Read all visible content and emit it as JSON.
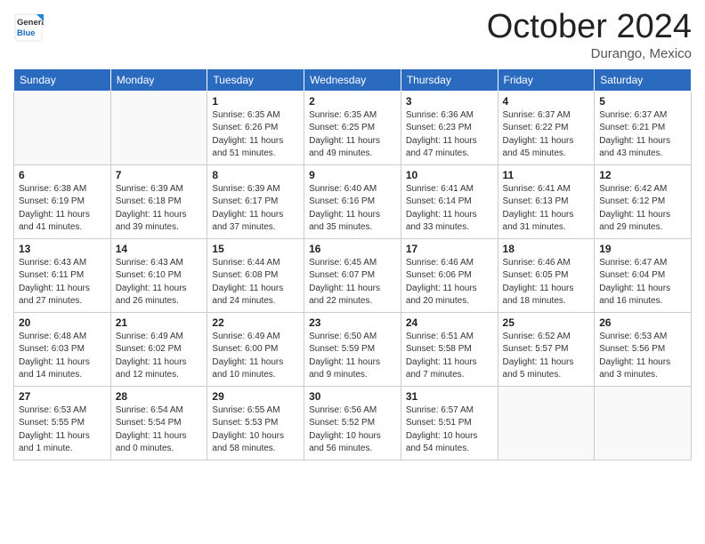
{
  "header": {
    "logo": {
      "general": "General",
      "blue": "Blue"
    },
    "title": "October 2024",
    "subtitle": "Durango, Mexico"
  },
  "weekdays": [
    "Sunday",
    "Monday",
    "Tuesday",
    "Wednesday",
    "Thursday",
    "Friday",
    "Saturday"
  ],
  "weeks": [
    [
      {
        "day": "",
        "info": ""
      },
      {
        "day": "",
        "info": ""
      },
      {
        "day": "1",
        "info": "Sunrise: 6:35 AM\nSunset: 6:26 PM\nDaylight: 11 hours and 51 minutes."
      },
      {
        "day": "2",
        "info": "Sunrise: 6:35 AM\nSunset: 6:25 PM\nDaylight: 11 hours and 49 minutes."
      },
      {
        "day": "3",
        "info": "Sunrise: 6:36 AM\nSunset: 6:23 PM\nDaylight: 11 hours and 47 minutes."
      },
      {
        "day": "4",
        "info": "Sunrise: 6:37 AM\nSunset: 6:22 PM\nDaylight: 11 hours and 45 minutes."
      },
      {
        "day": "5",
        "info": "Sunrise: 6:37 AM\nSunset: 6:21 PM\nDaylight: 11 hours and 43 minutes."
      }
    ],
    [
      {
        "day": "6",
        "info": "Sunrise: 6:38 AM\nSunset: 6:19 PM\nDaylight: 11 hours and 41 minutes."
      },
      {
        "day": "7",
        "info": "Sunrise: 6:39 AM\nSunset: 6:18 PM\nDaylight: 11 hours and 39 minutes."
      },
      {
        "day": "8",
        "info": "Sunrise: 6:39 AM\nSunset: 6:17 PM\nDaylight: 11 hours and 37 minutes."
      },
      {
        "day": "9",
        "info": "Sunrise: 6:40 AM\nSunset: 6:16 PM\nDaylight: 11 hours and 35 minutes."
      },
      {
        "day": "10",
        "info": "Sunrise: 6:41 AM\nSunset: 6:14 PM\nDaylight: 11 hours and 33 minutes."
      },
      {
        "day": "11",
        "info": "Sunrise: 6:41 AM\nSunset: 6:13 PM\nDaylight: 11 hours and 31 minutes."
      },
      {
        "day": "12",
        "info": "Sunrise: 6:42 AM\nSunset: 6:12 PM\nDaylight: 11 hours and 29 minutes."
      }
    ],
    [
      {
        "day": "13",
        "info": "Sunrise: 6:43 AM\nSunset: 6:11 PM\nDaylight: 11 hours and 27 minutes."
      },
      {
        "day": "14",
        "info": "Sunrise: 6:43 AM\nSunset: 6:10 PM\nDaylight: 11 hours and 26 minutes."
      },
      {
        "day": "15",
        "info": "Sunrise: 6:44 AM\nSunset: 6:08 PM\nDaylight: 11 hours and 24 minutes."
      },
      {
        "day": "16",
        "info": "Sunrise: 6:45 AM\nSunset: 6:07 PM\nDaylight: 11 hours and 22 minutes."
      },
      {
        "day": "17",
        "info": "Sunrise: 6:46 AM\nSunset: 6:06 PM\nDaylight: 11 hours and 20 minutes."
      },
      {
        "day": "18",
        "info": "Sunrise: 6:46 AM\nSunset: 6:05 PM\nDaylight: 11 hours and 18 minutes."
      },
      {
        "day": "19",
        "info": "Sunrise: 6:47 AM\nSunset: 6:04 PM\nDaylight: 11 hours and 16 minutes."
      }
    ],
    [
      {
        "day": "20",
        "info": "Sunrise: 6:48 AM\nSunset: 6:03 PM\nDaylight: 11 hours and 14 minutes."
      },
      {
        "day": "21",
        "info": "Sunrise: 6:49 AM\nSunset: 6:02 PM\nDaylight: 11 hours and 12 minutes."
      },
      {
        "day": "22",
        "info": "Sunrise: 6:49 AM\nSunset: 6:00 PM\nDaylight: 11 hours and 10 minutes."
      },
      {
        "day": "23",
        "info": "Sunrise: 6:50 AM\nSunset: 5:59 PM\nDaylight: 11 hours and 9 minutes."
      },
      {
        "day": "24",
        "info": "Sunrise: 6:51 AM\nSunset: 5:58 PM\nDaylight: 11 hours and 7 minutes."
      },
      {
        "day": "25",
        "info": "Sunrise: 6:52 AM\nSunset: 5:57 PM\nDaylight: 11 hours and 5 minutes."
      },
      {
        "day": "26",
        "info": "Sunrise: 6:53 AM\nSunset: 5:56 PM\nDaylight: 11 hours and 3 minutes."
      }
    ],
    [
      {
        "day": "27",
        "info": "Sunrise: 6:53 AM\nSunset: 5:55 PM\nDaylight: 11 hours and 1 minute."
      },
      {
        "day": "28",
        "info": "Sunrise: 6:54 AM\nSunset: 5:54 PM\nDaylight: 11 hours and 0 minutes."
      },
      {
        "day": "29",
        "info": "Sunrise: 6:55 AM\nSunset: 5:53 PM\nDaylight: 10 hours and 58 minutes."
      },
      {
        "day": "30",
        "info": "Sunrise: 6:56 AM\nSunset: 5:52 PM\nDaylight: 10 hours and 56 minutes."
      },
      {
        "day": "31",
        "info": "Sunrise: 6:57 AM\nSunset: 5:51 PM\nDaylight: 10 hours and 54 minutes."
      },
      {
        "day": "",
        "info": ""
      },
      {
        "day": "",
        "info": ""
      }
    ]
  ]
}
